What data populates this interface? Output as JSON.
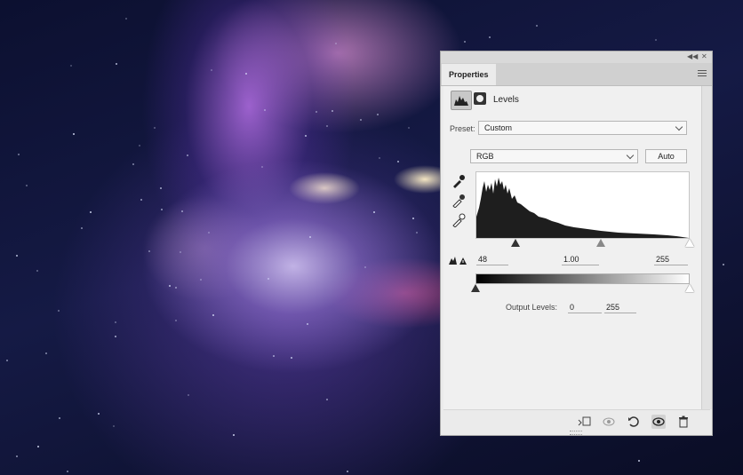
{
  "panel": {
    "tab_label": "Properties",
    "adjustment_title": "Levels",
    "preset_label": "Preset:",
    "preset_value": "Custom",
    "channel_value": "RGB",
    "auto_label": "Auto",
    "input_levels": {
      "black": "48",
      "mid": "1.00",
      "white": "255"
    },
    "input_slider_fractions": {
      "black": 0.188,
      "mid": 0.585,
      "white": 1.0
    },
    "output_label": "Output Levels:",
    "output_levels": {
      "black": "0",
      "white": "255"
    },
    "output_slider_fractions": {
      "black": 0.0,
      "white": 1.0
    }
  },
  "icons": {
    "titlebar": [
      "collapse-icon",
      "close-icon"
    ],
    "header": [
      "levels-adjustment-icon",
      "layer-mask-icon"
    ],
    "eyedroppers": [
      "black-point-eyedropper-icon",
      "gray-point-eyedropper-icon",
      "white-point-eyedropper-icon"
    ],
    "footer": [
      "clip-to-layer-icon",
      "view-previous-state-icon",
      "reset-icon",
      "visibility-icon",
      "delete-icon"
    ]
  },
  "colors": {
    "panel_bg": "#ebebeb",
    "content_bg": "#f0f0f0",
    "histogram_fill": "#1e1e1e"
  }
}
